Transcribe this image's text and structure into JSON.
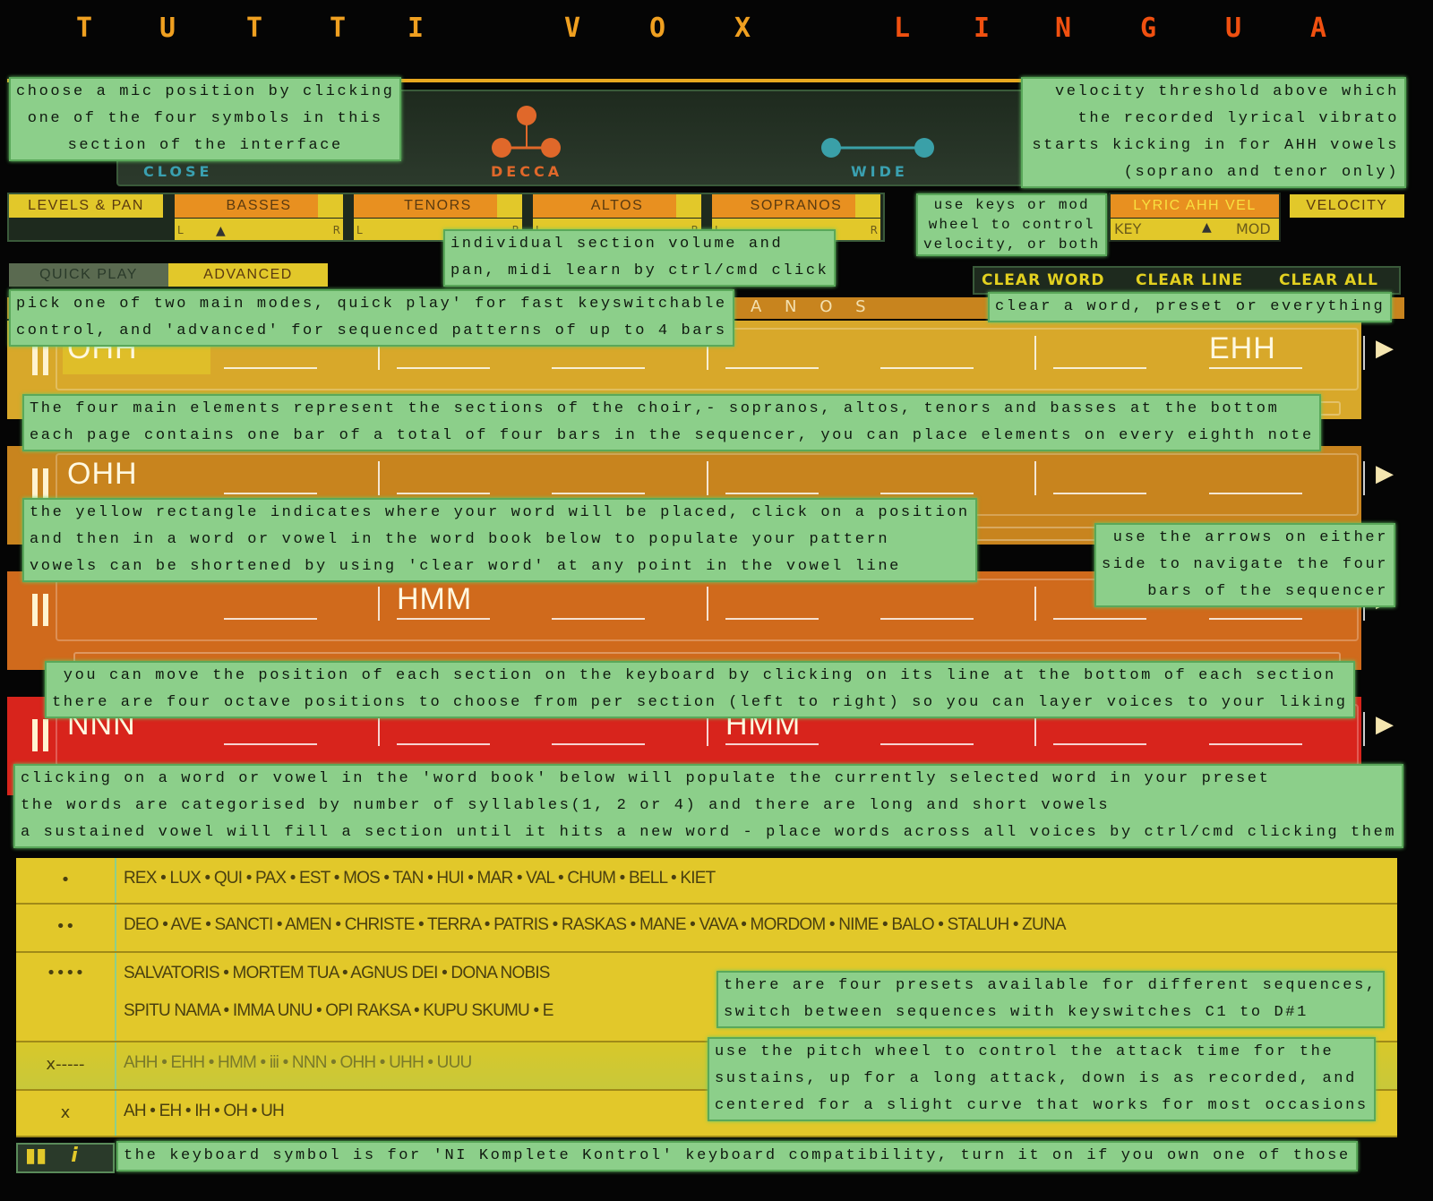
{
  "title": {
    "left": [
      "T",
      "U",
      "T",
      "T",
      "I",
      "V",
      "O",
      "X"
    ],
    "right": [
      "L",
      "I",
      "N",
      "G",
      "U",
      "A"
    ],
    "left_color": "#f0a020",
    "right_color": "#f05010"
  },
  "mic": {
    "close": "CLOSE",
    "decca": "DECCA",
    "wide": "WIDE"
  },
  "levels": {
    "label": "LEVELS & PAN",
    "sections": [
      "BASSES",
      "TENORS",
      "ALTOS",
      "SOPRANOS"
    ],
    "pan_l": "L",
    "pan_r": "R"
  },
  "velocity": {
    "lyric": "LYRIC AHH VEL",
    "velocity": "VELOCITY",
    "key": "KEY",
    "mod": "MOD"
  },
  "modes": {
    "quick": "QUICK PLAY",
    "advanced": "ADVANCED"
  },
  "clear": {
    "word": "CLEAR WORD",
    "line": "CLEAR LINE",
    "all": "CLEAR ALL"
  },
  "section_header": "A N O S",
  "lanes": [
    {
      "color": "#d8a82a",
      "words": [
        {
          "slot": 0,
          "text": "OHH"
        },
        {
          "slot": 7,
          "text": "EHH"
        }
      ]
    },
    {
      "color": "#c8841e",
      "words": [
        {
          "slot": 0,
          "text": "OHH"
        }
      ]
    },
    {
      "color": "#d06a1c",
      "words": [
        {
          "slot": 2,
          "text": "HMM"
        }
      ]
    },
    {
      "color": "#d8241c",
      "words": [
        {
          "slot": 0,
          "text": "NNN"
        },
        {
          "slot": 4,
          "text": "HMM"
        }
      ]
    }
  ],
  "wordbook": [
    {
      "label": "•",
      "lines": [
        "REX • LUX • QUI • PAX • EST • MOS • TAN • HUI • MAR • VAL • CHUM • BELL • KIET"
      ]
    },
    {
      "label": "••",
      "lines": [
        "DEO • AVE • SANCTI • AMEN • CHRISTE • TERRA • PATRIS • RASKAS • MANE • VAVA • MORDOM • NIME • BALO • STALUH • ZUNA"
      ]
    },
    {
      "label": "••••",
      "lines": [
        "SALVATORIS • MORTEM TUA • AGNUS DEI • DONA NOBIS",
        "SPITU NAMA • IMMA UNU • OPI RAKSA • KUPU SKUMU • E"
      ]
    },
    {
      "label": "x-----",
      "lines": [
        "AHH • EHH • HMM • iii • NNN • OHH • UHH • UUU"
      ]
    },
    {
      "label": "x",
      "lines": [
        "AH • EH • IH • OH • UH"
      ]
    }
  ],
  "tips": {
    "mic": [
      "choose a mic position by clicking",
      "one of the four symbols in this",
      "section of the interface"
    ],
    "vel_threshold": [
      "velocity threshold above which",
      "the recorded lyrical vibrato",
      "starts kicking in for AHH vowels",
      "(soprano and tenor only)"
    ],
    "keys_mod": [
      "use keys or mod",
      "wheel to control",
      "velocity, or both"
    ],
    "section_vol": [
      "individual section volume and",
      "pan, midi learn by ctrl/cmd click"
    ],
    "modes": [
      "pick one of two main modes, quick play' for fast keyswitchable",
      "control, and 'advanced' for sequenced patterns of up to 4 bars"
    ],
    "clear": [
      "clear a word, preset or everything"
    ],
    "elements": [
      "The four main elements represent the sections of the choir,- sopranos, altos, tenors and basses at the bottom",
      "each page contains one bar of a total of four bars in the sequencer, you can place elements on every eighth note"
    ],
    "yellow": [
      "the yellow rectangle indicates where your word will be placed, click on a position",
      "and then in a word or vowel in the word book below to populate your pattern",
      "vowels can be shortened by using 'clear word' at any point in the vowel line"
    ],
    "arrows": [
      "use the arrows on either",
      "side to navigate the four",
      "bars of the sequencer"
    ],
    "keyboard": [
      "you can move the position of each section on the keyboard by clicking on its line at the bottom of each section",
      "there are four octave positions to choose from per section (left to right) so you can layer voices to your liking"
    ],
    "wordbook": [
      "clicking on a word or vowel in the 'word book' below will populate the currently selected word in your preset",
      "the words are categorised by number of syllables(1, 2 or 4) and there are long and short vowels",
      "a sustained vowel will fill a section until it hits a new word - place words across all voices by ctrl/cmd clicking them"
    ],
    "presets": [
      "there are four presets available for different sequences,",
      "switch between sequences with keyswitches C1 to D#1"
    ],
    "pitch": [
      "use the pitch wheel to control the attack time for the",
      "sustains, up for a long attack, down is as recorded, and",
      "centered for a slight curve that works for most occasions"
    ],
    "komplete": [
      "the keyboard symbol is for 'NI Komplete Kontrol' keyboard compatibility, turn it on if you own one of those"
    ]
  }
}
